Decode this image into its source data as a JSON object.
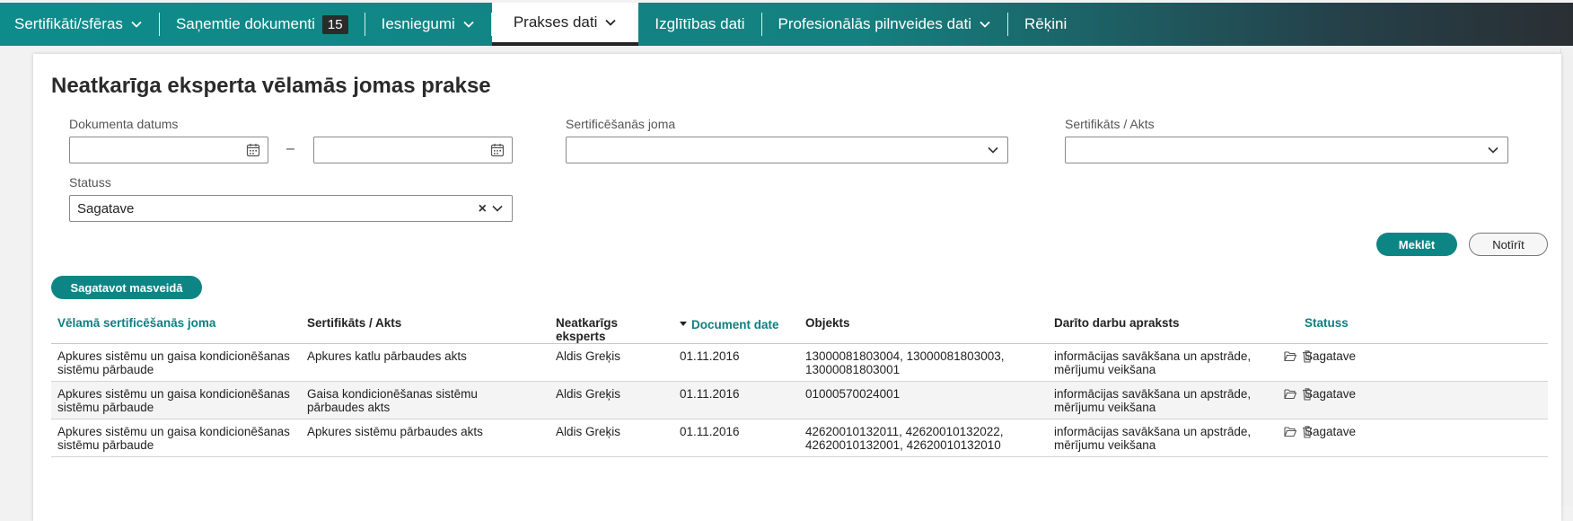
{
  "nav": {
    "items": [
      {
        "label": "Sertifikāti/sfēras",
        "has_dropdown": true
      },
      {
        "label": "Saņemtie dokumenti",
        "badge": "15",
        "has_dropdown": false
      },
      {
        "label": "Iesniegumi",
        "has_dropdown": true
      },
      {
        "label": "Prakses dati",
        "has_dropdown": true,
        "active": true
      },
      {
        "label": "Izglītības dati",
        "has_dropdown": false
      },
      {
        "label": "Profesionālās pilnveides dati",
        "has_dropdown": true
      },
      {
        "label": "Rēķini",
        "has_dropdown": false
      }
    ]
  },
  "page": {
    "title": "Neatkarīga eksperta vēlamās jomas prakse"
  },
  "filters": {
    "doc_date_label": "Dokumenta datums",
    "date_from": "",
    "date_to": "",
    "date_separator": "–",
    "cert_area_label": "Sertificēšanās joma",
    "cert_area_value": "",
    "cert_act_label": "Sertifikāts / Akts",
    "cert_act_value": "",
    "status_label": "Statuss",
    "status_value": "Sagatave"
  },
  "actions": {
    "search_label": "Meklēt",
    "clear_label": "Notīrīt",
    "bulk_prepare_label": "Sagatavot masveidā"
  },
  "table": {
    "headers": {
      "area": "Vēlamā sertificēšanās joma",
      "cert": "Sertifikāts / Akts",
      "expert": "Neatkarīgs eksperts",
      "date": "Document date",
      "object": "Objekts",
      "work": "Darīto darbu apraksts",
      "status": "Statuss"
    },
    "rows": [
      {
        "area": "Apkures sistēmu un gaisa kondicionēšanas sistēmu pārbaude",
        "cert": "Apkures katlu pārbaudes akts",
        "expert": "Aldis Greķis",
        "date": "01.11.2016",
        "object": "13000081803004, 13000081803003, 13000081803001",
        "work": "informācijas savākšana un apstrāde, mērījumu veikšana",
        "status": "Sagatave"
      },
      {
        "area": "Apkures sistēmu un gaisa kondicionēšanas sistēmu pārbaude",
        "cert": "Gaisa kondicionēšanas sistēmu pārbaudes akts",
        "expert": "Aldis Greķis",
        "date": "01.11.2016",
        "object": "01000570024001",
        "work": "informācijas savākšana un apstrāde, mērījumu veikšana",
        "status": "Sagatave"
      },
      {
        "area": "Apkures sistēmu un gaisa kondicionēšanas sistēmu pārbaude",
        "cert": "Apkures sistēmu pārbaudes akts",
        "expert": "Aldis Greķis",
        "date": "01.11.2016",
        "object": "42620010132011, 42620010132022, 42620010132001, 42620010132010",
        "work": "informācijas savākšana un apstrāde, mērījumu veikšana",
        "status": "Sagatave"
      }
    ]
  },
  "colors": {
    "accent": "#0e8585",
    "nav_start": "#0e8c8c",
    "nav_end": "#2a2f33"
  }
}
